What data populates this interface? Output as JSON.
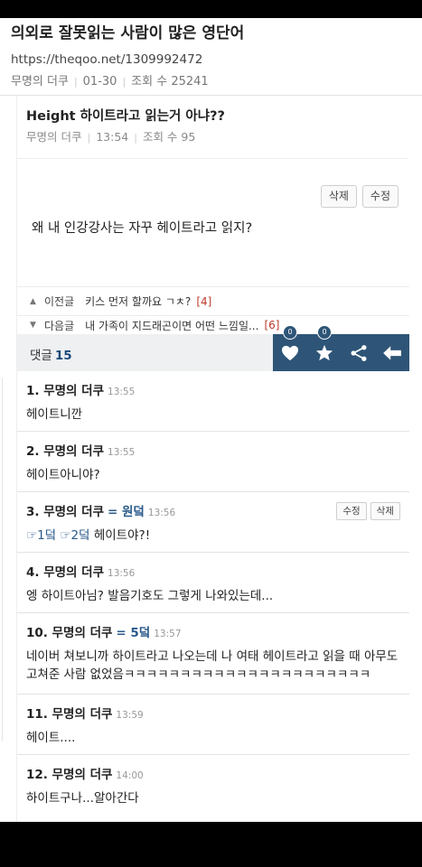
{
  "page": {
    "title": "의외로 잘못읽는 사람이 많은 영단어",
    "url": "https://theqoo.net/1309992472",
    "author": "무명의 더쿠",
    "date": "01-30",
    "views_label": "조회 수",
    "views": "25241"
  },
  "post": {
    "title": "Height 하이트라고 읽는거 아냐??",
    "author": "무명의 더쿠",
    "time": "13:54",
    "views_label": "조회 수",
    "views": "95",
    "delete_label": "삭제",
    "edit_label": "수정",
    "body": "왜 내 인강강사는 자꾸 헤이트라고 읽지?"
  },
  "nav": {
    "prev": {
      "label": "이전글",
      "title": "키스 먼저 할까요 ㄱㅊ?",
      "count": "[4]"
    },
    "next": {
      "label": "다음글",
      "title": "내 가족이 지드래곤이면 어떤 느낌일...",
      "count": "[6]"
    }
  },
  "comment_bar": {
    "label": "댓글",
    "count": "15",
    "like_count": "0",
    "star_count": "0",
    "icons": [
      "heart-icon",
      "star-icon",
      "share-icon",
      "back-arrow-icon"
    ],
    "accent": "#2e5577"
  },
  "comments": [
    {
      "head": "1. 무명의 더쿠",
      "time": "13:55",
      "body": "헤이트니깐"
    },
    {
      "head": "2. 무명의 더쿠",
      "time": "13:55",
      "body": "헤이트아니야?"
    },
    {
      "head": "3. 무명의 더쿠",
      "grade": "= 원덬",
      "time": "13:56",
      "ref1": "☞1덬",
      "ref2": "☞2덬",
      "body": "헤이트야?!",
      "edit_label": "수정",
      "delete_label": "삭제"
    },
    {
      "head": "4. 무명의 더쿠",
      "time": "13:56",
      "body": "엥 하이트아님? 발음기호도 그렇게 나와있는데..."
    },
    {
      "head": "10. 무명의 더쿠",
      "grade": "= 5덬",
      "time": "13:57",
      "body": "네이버 쳐보니까 하이트라고 나오는데 나 여태 헤이트라고 읽을 때 아무도 고쳐준 사람 없었음ㅋㅋㅋㅋㅋㅋㅋㅋㅋㅋㅋㅋㅋㅋㅋㅋㅋㅋㅋㅋㅋㅋ"
    },
    {
      "head": "11. 무명의 더쿠",
      "time": "13:59",
      "body": "헤이트...."
    },
    {
      "head": "12. 무명의 더쿠",
      "time": "14:00",
      "body": "하이트구나...알아간다"
    }
  ]
}
